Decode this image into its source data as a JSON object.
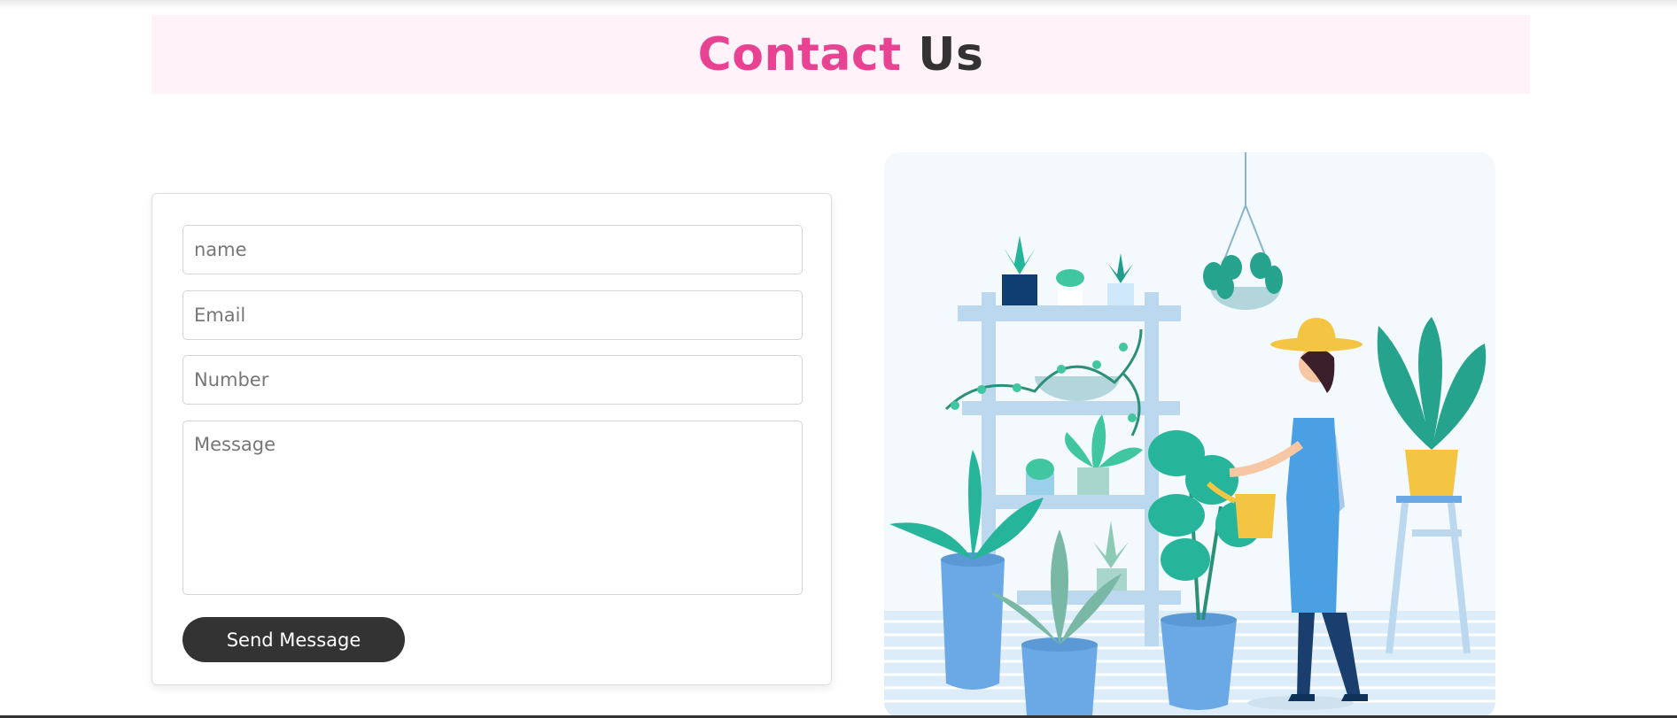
{
  "heading": {
    "accent": "Contact",
    "rest": "Us"
  },
  "form": {
    "name_placeholder": "name",
    "email_placeholder": "Email",
    "number_placeholder": "Number",
    "message_placeholder": "Message",
    "send_label": "Send Message"
  },
  "illustration": {
    "icon": "gardener-watering-plants-illustration"
  },
  "colors": {
    "accent": "#e84393",
    "dark": "#333333",
    "heading_bg": "#fff2f9"
  }
}
